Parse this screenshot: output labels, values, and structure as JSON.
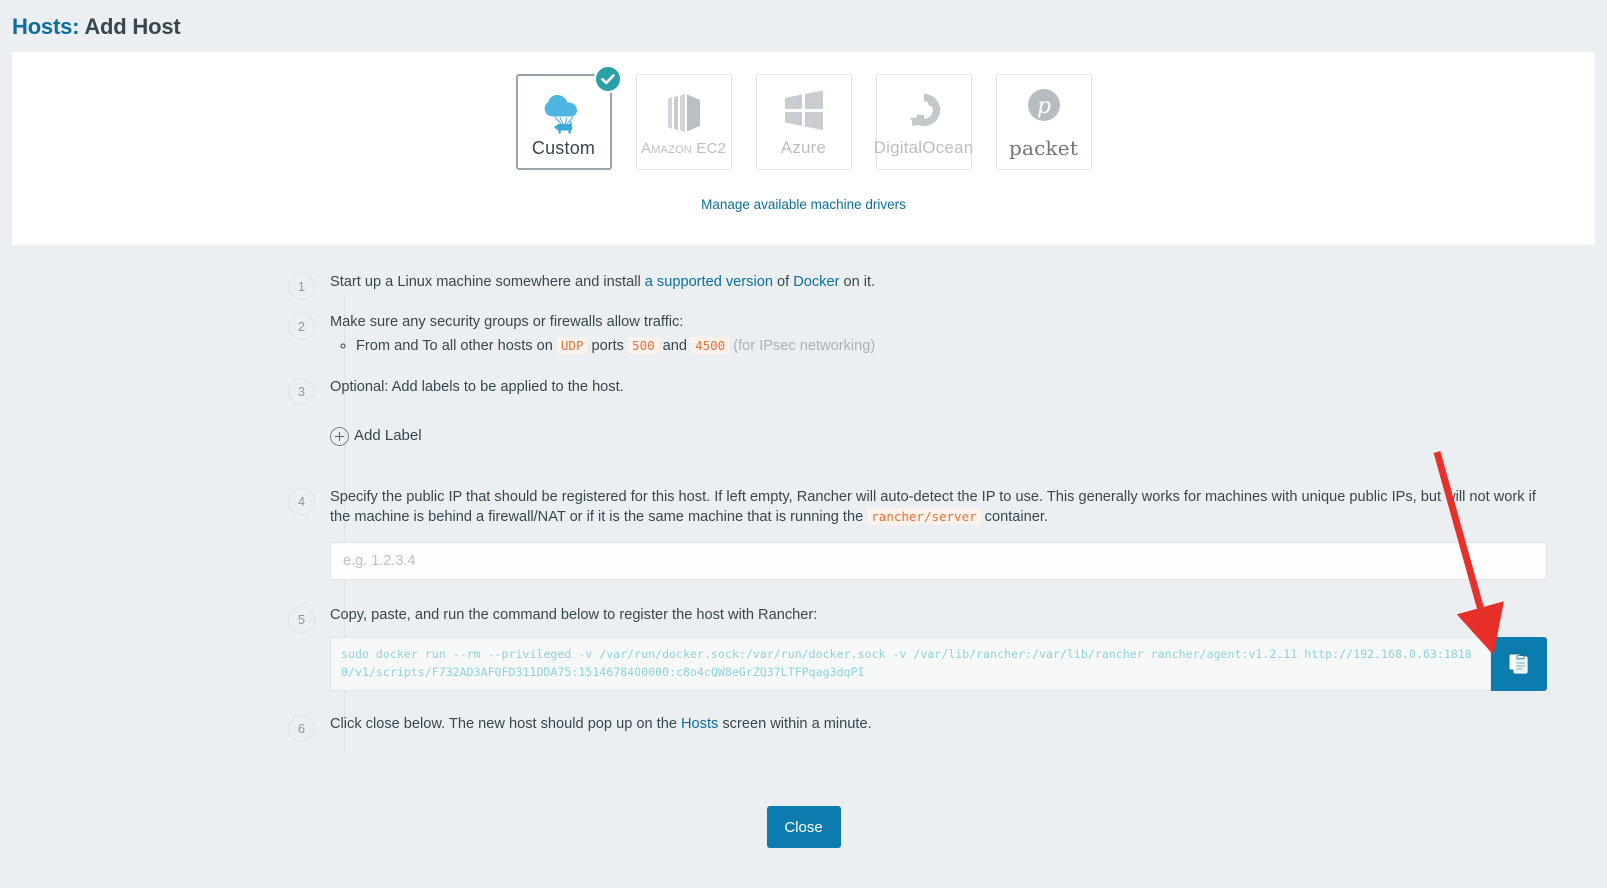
{
  "header": {
    "breadcrumb": "Hosts:",
    "title": "Add Host"
  },
  "drivers": {
    "manage_link": "Manage available machine drivers",
    "selected": "Custom",
    "items": [
      {
        "label": "Custom",
        "icon": "rancher-cloud-cow-icon",
        "selected": true
      },
      {
        "label": "Amazon EC2",
        "icon": "amazon-ec2-icon",
        "selected": false
      },
      {
        "label": "Azure",
        "icon": "azure-windows-icon",
        "selected": false
      },
      {
        "label": "DigitalOcean",
        "icon": "digitalocean-icon",
        "selected": false
      },
      {
        "label": "packet",
        "icon": "packet-icon",
        "selected": false
      }
    ]
  },
  "steps": {
    "s1": {
      "num": "1",
      "text_a": "Start up a Linux machine somewhere and install ",
      "link_a": "a supported version",
      "text_b": " of ",
      "link_b": "Docker",
      "text_c": " on it."
    },
    "s2": {
      "num": "2",
      "text": "Make sure any security groups or firewalls allow traffic:",
      "bullet_a": "From and To all other hosts on ",
      "code_udp": "UDP",
      "bullet_b": " ports ",
      "code_500": "500",
      "bullet_c": " and ",
      "code_4500": "4500",
      "bullet_d": " (for IPsec networking)"
    },
    "s3": {
      "num": "3",
      "text": "Optional: Add labels to be applied to the host.",
      "add_label": "Add Label"
    },
    "s4": {
      "num": "4",
      "text_a": "Specify the public IP that should be registered for this host. If left empty, Rancher will auto-detect the IP to use. This generally works for machines with unique public IPs, but will not work if the machine is behind a firewall/NAT or if it is the same machine that is running the ",
      "code_container": "rancher/server",
      "text_b": " container.",
      "ip_placeholder": "e.g. 1.2.3.4",
      "ip_value": ""
    },
    "s5": {
      "num": "5",
      "text": "Copy, paste, and run the command below to register the host with Rancher:",
      "command": "sudo docker run --rm --privileged -v /var/run/docker.sock:/var/run/docker.sock -v /var/lib/rancher:/var/lib/rancher rancher/agent:v1.2.11 http://192.168.0.63:18180/v1/scripts/F732AD3AF0FD311DDA75:1514678400000:c8o4cQW8eGrZQ37LTFPqag3dqPI",
      "copy_icon": "clipboard-icon"
    },
    "s6": {
      "num": "6",
      "text_a": "Click close below. The new host should pop up on the ",
      "link": "Hosts",
      "text_b": " screen within a minute."
    }
  },
  "footer": {
    "close_label": "Close"
  },
  "colors": {
    "accent_blue": "#0b7cad",
    "link_blue": "#0b6e9e",
    "check_teal": "#2aa0a8",
    "code_orange": "#e8703a",
    "command_cyan": "#8ed2e0",
    "annotation_red": "#e8302a",
    "page_bg": "#eceff1"
  }
}
